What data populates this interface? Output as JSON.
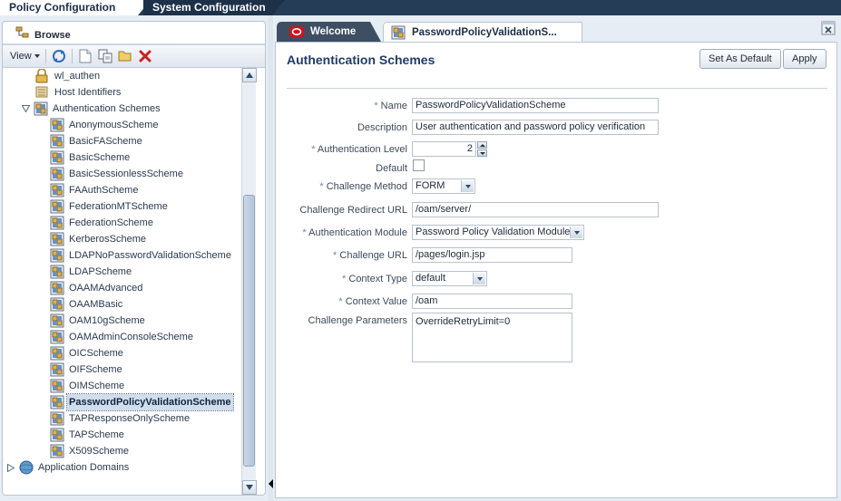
{
  "top_tabs": [
    {
      "label": "Policy Configuration",
      "active": true
    },
    {
      "label": "System Configuration",
      "active": false
    }
  ],
  "browse": {
    "tab_label": "Browse",
    "view_label": "View",
    "toolbar_icons": [
      "refresh-icon",
      "new-icon",
      "duplicate-icon",
      "open-icon",
      "delete-icon"
    ]
  },
  "tree": {
    "items": [
      {
        "label": "wl_authen",
        "icon": "lock-icon"
      },
      {
        "label": "Host Identifiers",
        "icon": "folder-icon"
      },
      {
        "label": "Authentication Schemes",
        "icon": "scheme-folder-icon",
        "expanded": true
      },
      {
        "label": "AnonymousScheme",
        "icon": "scheme-icon"
      },
      {
        "label": "BasicFAScheme",
        "icon": "scheme-icon"
      },
      {
        "label": "BasicScheme",
        "icon": "scheme-icon"
      },
      {
        "label": "BasicSessionlessScheme",
        "icon": "scheme-icon"
      },
      {
        "label": "FAAuthScheme",
        "icon": "scheme-icon"
      },
      {
        "label": "FederationMTScheme",
        "icon": "scheme-icon"
      },
      {
        "label": "FederationScheme",
        "icon": "scheme-icon"
      },
      {
        "label": "KerberosScheme",
        "icon": "scheme-icon"
      },
      {
        "label": "LDAPNoPasswordValidationScheme",
        "icon": "scheme-icon"
      },
      {
        "label": "LDAPScheme",
        "icon": "scheme-icon"
      },
      {
        "label": "OAAMAdvanced",
        "icon": "scheme-icon"
      },
      {
        "label": "OAAMBasic",
        "icon": "scheme-icon"
      },
      {
        "label": "OAM10gScheme",
        "icon": "scheme-icon"
      },
      {
        "label": "OAMAdminConsoleScheme",
        "icon": "scheme-icon"
      },
      {
        "label": "OICScheme",
        "icon": "scheme-icon"
      },
      {
        "label": "OIFScheme",
        "icon": "scheme-icon"
      },
      {
        "label": "OIMScheme",
        "icon": "scheme-icon"
      },
      {
        "label": "PasswordPolicyValidationScheme",
        "icon": "scheme-icon",
        "selected": true
      },
      {
        "label": "TAPResponseOnlyScheme",
        "icon": "scheme-icon"
      },
      {
        "label": "TAPScheme",
        "icon": "scheme-icon"
      },
      {
        "label": "X509Scheme",
        "icon": "scheme-icon"
      },
      {
        "label": "Application Domains",
        "icon": "globe-icon",
        "expanded": false
      }
    ]
  },
  "doc_tabs": [
    {
      "label": "Welcome",
      "icon": "oracle-logo-icon"
    },
    {
      "label": "PasswordPolicyValidationS...",
      "icon": "scheme-icon"
    }
  ],
  "content": {
    "title": "Authentication Schemes",
    "set_default_label": "Set As Default",
    "apply_label": "Apply",
    "form": {
      "name": {
        "label": "Name",
        "required": true,
        "value": "PasswordPolicyValidationScheme"
      },
      "description": {
        "label": "Description",
        "required": false,
        "value": "User authentication and password policy verification"
      },
      "auth_level": {
        "label": "Authentication Level",
        "required": true,
        "value": "2"
      },
      "default": {
        "label": "Default",
        "required": false,
        "checked": false
      },
      "challenge_method": {
        "label": "Challenge Method",
        "required": true,
        "value": "FORM"
      },
      "challenge_redirect_url": {
        "label": "Challenge Redirect URL",
        "required": false,
        "value": "/oam/server/"
      },
      "auth_module": {
        "label": "Authentication Module",
        "required": true,
        "value": "Password Policy Validation Module"
      },
      "challenge_url": {
        "label": "Challenge URL",
        "required": true,
        "value": "/pages/login.jsp"
      },
      "context_type": {
        "label": "Context Type",
        "required": true,
        "value": "default"
      },
      "context_value": {
        "label": "Context Value",
        "required": true,
        "value": "/oam"
      },
      "challenge_parameters": {
        "label": "Challenge Parameters",
        "required": false,
        "value": "OverrideRetryLimit=0"
      }
    }
  },
  "colors": {
    "top_bar": "#263d58",
    "title_blue": "#1f3c6a",
    "selection": "#d1ddeb",
    "background": "#e7edf4"
  }
}
